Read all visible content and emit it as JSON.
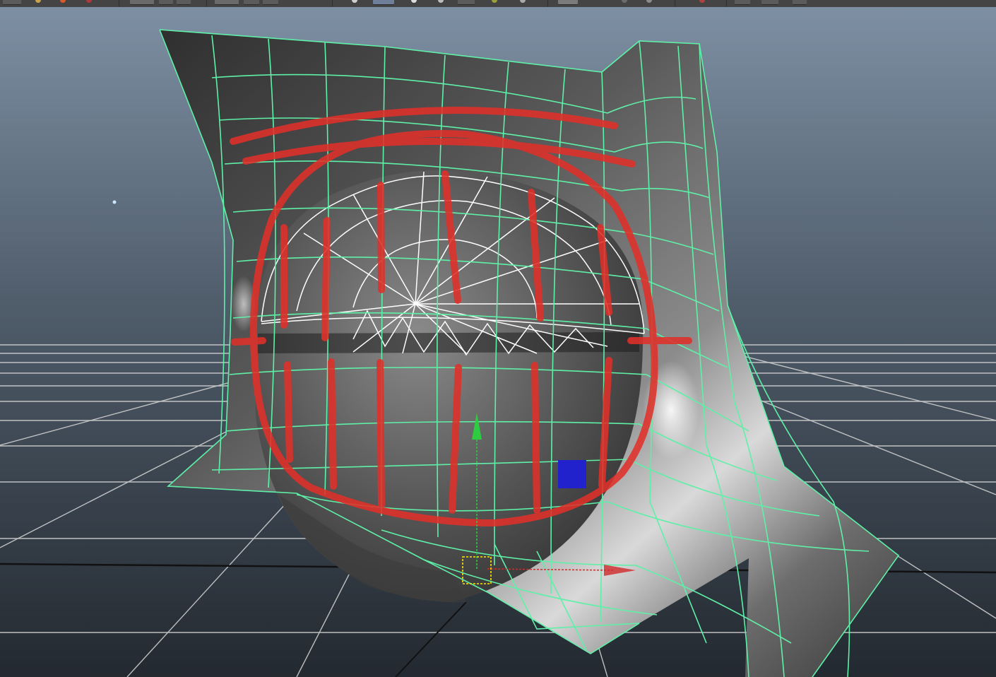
{
  "window": {
    "title": ""
  },
  "toolbar": {
    "icons": [
      "select-tool-icon",
      "lasso-tool-icon",
      "paint-tool-icon",
      "move-tool-icon",
      "rotate-tool-icon",
      "scale-tool-icon",
      "snap-grid-icon",
      "snap-curve-icon",
      "snap-point-icon",
      "render-icon",
      "ipr-render-icon",
      "render-settings-icon",
      "camera-icon",
      "panel-layout-icon"
    ]
  },
  "viewport": {
    "view": "perspective",
    "colors": {
      "background_top": "#7d8fa3",
      "background_bottom": "#232930",
      "grid_line": "#cfcfcf",
      "grid_axis": "#111111",
      "wireframe_selected": "#5ff0a8",
      "wireframe_white": "#ffffff",
      "annotation_red": "#e0302a",
      "manipulator_y": "#2ecc40",
      "manipulator_x": "#d02a2a",
      "manipulator_z": "#2222cc",
      "pivot": "#ffe600"
    },
    "objects": [
      "deformed-plane-mesh",
      "eyeball-sphere"
    ],
    "annotation": "red-paint-over-strokes",
    "manipulator": "move-tool"
  }
}
